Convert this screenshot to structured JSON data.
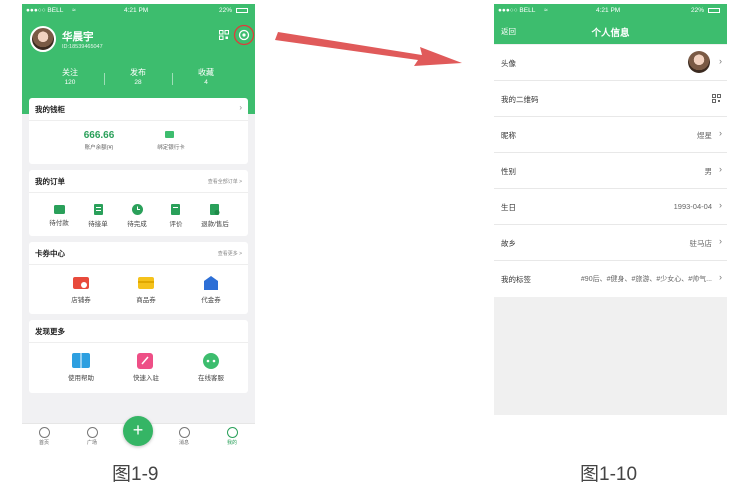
{
  "status1": {
    "carrier": "●●●○○ BELL",
    "wifi": "≈",
    "time": "4:21 PM",
    "battery": "22%"
  },
  "profile": {
    "name": "华晨宇",
    "id": "ID:18539465047"
  },
  "stats": [
    {
      "label": "关注",
      "value": "120"
    },
    {
      "label": "发布",
      "value": "28"
    },
    {
      "label": "收藏",
      "value": "4"
    }
  ],
  "wallet": {
    "title": "我的钱柜",
    "balance": "666.66",
    "balance_label": "账户余额(¥)",
    "bind_card": "绑定银行卡"
  },
  "orders": {
    "title": "我的订单",
    "more": "查看全部订单 >",
    "items": [
      "待付款",
      "待接单",
      "待完成",
      "评价",
      "退款/售后"
    ]
  },
  "coupons": {
    "title": "卡券中心",
    "more": "查看更多 >",
    "items": [
      "店铺券",
      "商品券",
      "代金券"
    ]
  },
  "discover": {
    "title": "发现更多",
    "items": [
      "使用帮助",
      "快速入驻",
      "在线客服"
    ]
  },
  "tabs": [
    "首页",
    "广场",
    "消息",
    "我的"
  ],
  "plus": "+",
  "status2": {
    "carrier": "●●●○○ BELL",
    "wifi": "≈",
    "time": "4:21 PM",
    "battery": "22%"
  },
  "info": {
    "back": "返回",
    "title": "个人信息",
    "rows": [
      {
        "label": "头像",
        "value": ""
      },
      {
        "label": "我的二维码",
        "value": ""
      },
      {
        "label": "昵称",
        "value": "煜星"
      },
      {
        "label": "性别",
        "value": "男"
      },
      {
        "label": "生日",
        "value": "1993-04-04"
      },
      {
        "label": "故乡",
        "value": "驻马店"
      },
      {
        "label": "我的标签",
        "value": "#90后、#健身、#旅游、#少女心、#帅气..."
      }
    ]
  },
  "captions": [
    "图1-9",
    "图1-10"
  ],
  "colors": {
    "primary": "#3dbd6e",
    "arrow": "#e05a5a",
    "highlight_circle": "#e03a3a"
  }
}
